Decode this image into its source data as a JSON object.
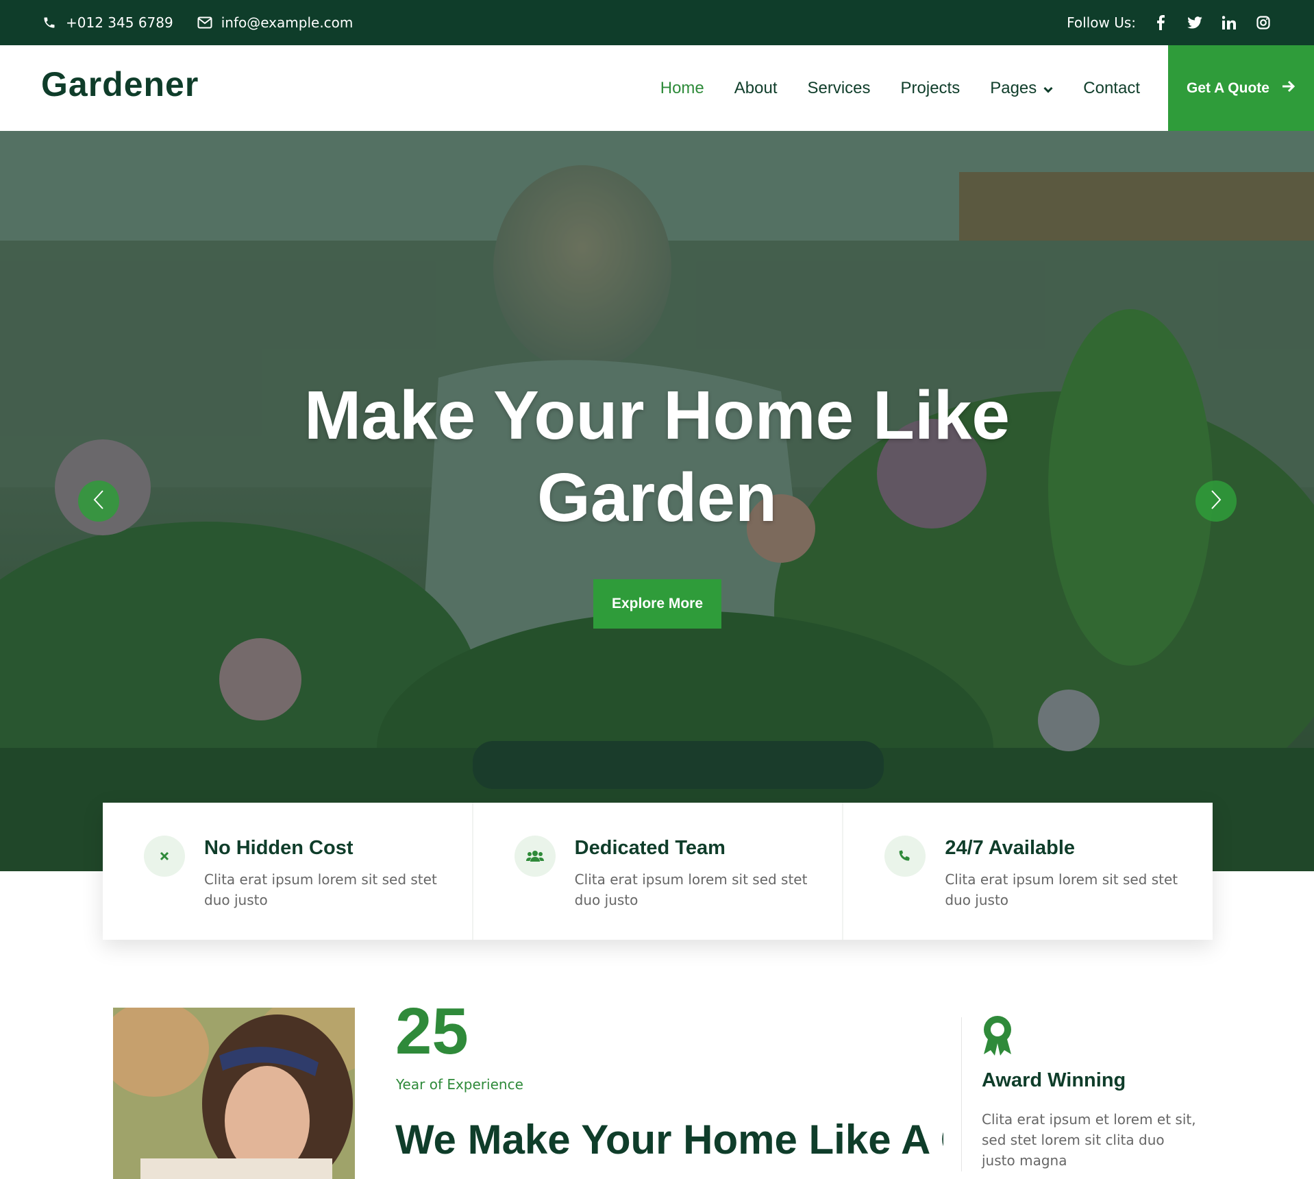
{
  "topbar": {
    "phone": "+012 345 6789",
    "email": "info@example.com",
    "follow_label": "Follow Us:",
    "socials": [
      {
        "name": "facebook-icon",
        "glyph": "f"
      },
      {
        "name": "twitter-icon",
        "glyph": "t"
      },
      {
        "name": "linkedin-icon",
        "glyph": "in"
      },
      {
        "name": "instagram-icon",
        "glyph": "ig"
      }
    ]
  },
  "nav": {
    "brand": "Gardener",
    "items": [
      {
        "label": "Home",
        "active": true
      },
      {
        "label": "About",
        "active": false
      },
      {
        "label": "Services",
        "active": false
      },
      {
        "label": "Projects",
        "active": false
      },
      {
        "label": "Pages",
        "active": false,
        "dropdown": true
      },
      {
        "label": "Contact",
        "active": false
      }
    ],
    "cta": "Get A Quote"
  },
  "hero": {
    "headline_line1": "Make Your Home Like",
    "headline_line2": "Garden",
    "button": "Explore More"
  },
  "features": [
    {
      "icon": "close-icon",
      "title": "No Hidden Cost",
      "text": "Clita erat ipsum lorem sit sed stet duo justo"
    },
    {
      "icon": "users-icon",
      "title": "Dedicated Team",
      "text": "Clita erat ipsum lorem sit sed stet duo justo"
    },
    {
      "icon": "phone-icon",
      "title": "24/7 Available",
      "text": "Clita erat ipsum lorem sit sed stet duo justo"
    }
  ],
  "about": {
    "years": "25",
    "years_label": "Year of Experience",
    "title": "We Make Your Home Like A Garden",
    "award_title": "Award Winning",
    "award_text": "Clita erat ipsum et lorem et sit, sed stet lorem sit clita duo justo magna"
  },
  "colors": {
    "dark_green": "#0f3d2a",
    "accent_green": "#2f9c3a"
  }
}
